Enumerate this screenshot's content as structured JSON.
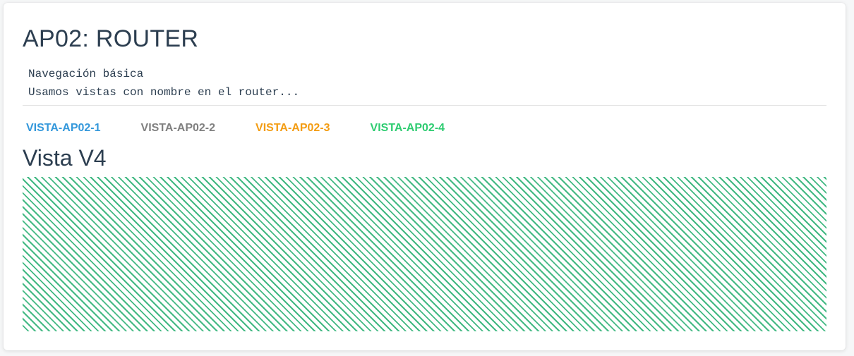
{
  "app": {
    "title": "AP02: ROUTER",
    "description": [
      "Navegación básica",
      "Usamos vistas con nombre en el router..."
    ]
  },
  "nav": {
    "links": [
      {
        "label": "VISTA-AP02-1",
        "color": "#3498db"
      },
      {
        "label": "VISTA-AP02-2",
        "color": "#808080"
      },
      {
        "label": "VISTA-AP02-3",
        "color": "#f39c12"
      },
      {
        "label": "VISTA-AP02-4",
        "color": "#2ecc71"
      }
    ]
  },
  "view": {
    "title": "Vista V4",
    "pattern_color": "#42b983"
  }
}
